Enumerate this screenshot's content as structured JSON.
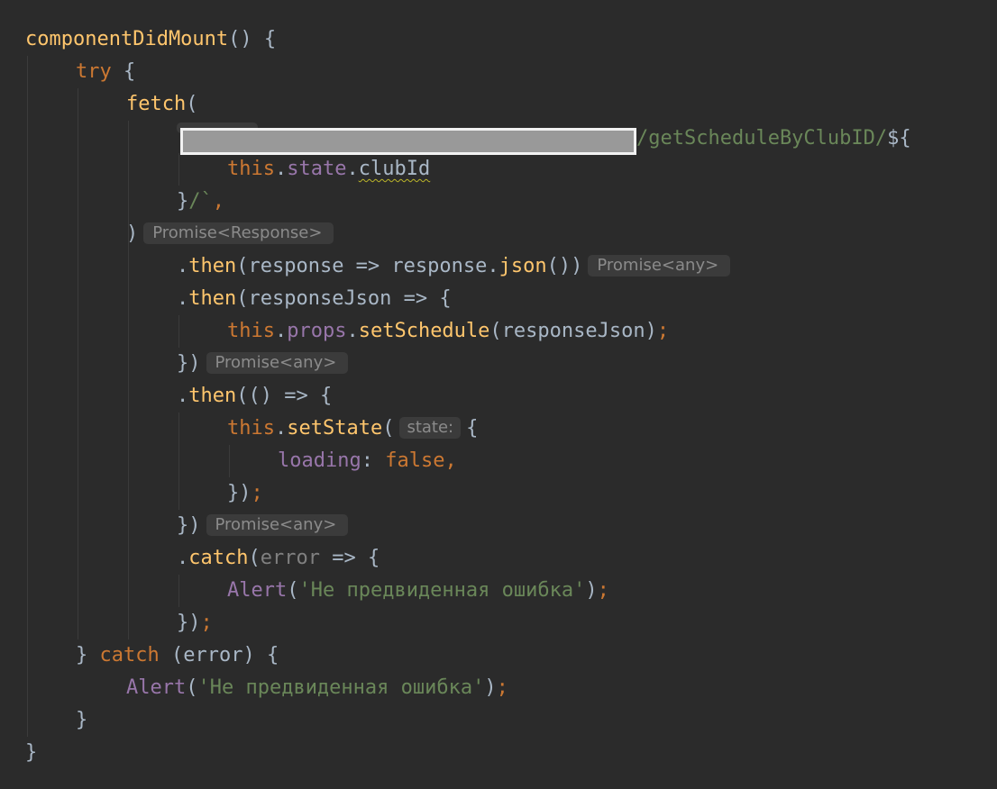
{
  "code": {
    "l1": {
      "name": "componentDidMount",
      "rest": "() {"
    },
    "l2": {
      "kw": "try",
      "rest": " {"
    },
    "l3": {
      "name": "fetch",
      "rest": "("
    },
    "l4": {
      "str": "/getScheduleByClubID/",
      "tail": "${"
    },
    "l5": {
      "this": "this",
      "dot1": ".",
      "prop": "state",
      "dot2": ".",
      "field": "clubId"
    },
    "l6": {
      "brace": "}",
      "str": "/`",
      "comma": ","
    },
    "l7": {
      "paren": ")",
      "hint": "Promise<Response>"
    },
    "l8": {
      "dot": ".",
      "method": "then",
      "a": "(response => response.",
      "call": "json",
      "b": "())",
      "hint": "Promise<any>"
    },
    "l9": {
      "dot": ".",
      "method": "then",
      "a": "(responseJson => {"
    },
    "l10": {
      "this": "this",
      "dot1": ".",
      "prop": "props",
      "dot2": ".",
      "method": "setSchedule",
      "a": "(responseJson)",
      "semi": ";"
    },
    "l11": {
      "a": "})",
      "hint": "Promise<any>"
    },
    "l12": {
      "dot": ".",
      "method": "then",
      "a": "(() => {"
    },
    "l13": {
      "this": "this",
      "dot1": ".",
      "method": "setState",
      "a": "(",
      "hint": "state:",
      "b": "{"
    },
    "l14": {
      "key": "loading",
      "colon": ": ",
      "val": "false",
      "comma": ","
    },
    "l15": {
      "a": "})",
      "semi": ";"
    },
    "l16": {
      "a": "})",
      "hint": "Promise<any>"
    },
    "l17": {
      "dot": ".",
      "method": "catch",
      "a": "(",
      "param": "error",
      "b": " => {"
    },
    "l18": {
      "fn": "Alert",
      "a": "(",
      "str": "'Не предвиденная ошибка'",
      "b": ")",
      "semi": ";"
    },
    "l19": {
      "a": "})",
      "semi": ";"
    },
    "l20": {
      "a": "} ",
      "kw": "catch",
      "b": " (error) {"
    },
    "l21": {
      "fn": "Alert",
      "a": "(",
      "str": "'Не предвиденная ошибка'",
      "b": ")",
      "semi": ";"
    },
    "l22": {
      "a": "}"
    },
    "l23": {
      "a": "}"
    }
  },
  "colors": {
    "background": "#2b2b2b",
    "function": "#ffc66d",
    "keyword": "#cc7832",
    "string": "#6a8759",
    "field": "#9876aa",
    "text": "#a9b7c6",
    "inlay_hint": "#8b8b8b"
  }
}
